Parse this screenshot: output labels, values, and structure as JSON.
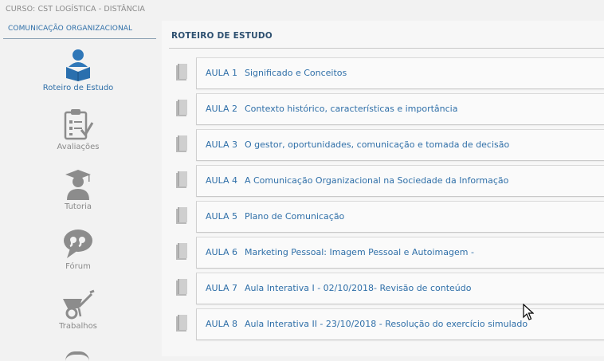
{
  "course": {
    "label": "CURSO: CST LOGÍSTICA - DISTÂNCIA"
  },
  "sidebar": {
    "module_title": "COMUNICAÇÃO ORGANIZACIONAL",
    "items": [
      {
        "label": "Roteiro de Estudo",
        "icon": "student-book-icon",
        "active": true
      },
      {
        "label": "Avaliações",
        "icon": "clipboard-check-icon",
        "active": false
      },
      {
        "label": "Tutoria",
        "icon": "graduate-icon",
        "active": false
      },
      {
        "label": "Fórum",
        "icon": "speech-bubble-icon",
        "active": false
      },
      {
        "label": "Trabalhos",
        "icon": "wheelbarrow-icon",
        "active": false
      }
    ]
  },
  "main": {
    "title": "ROTEIRO DE ESTUDO",
    "lessons": [
      {
        "number": "AULA 1",
        "title": "Significado e Conceitos"
      },
      {
        "number": "AULA 2",
        "title": "Contexto histórico, características e importância"
      },
      {
        "number": "AULA 3",
        "title": "O gestor, oportunidades, comunicação e tomada de decisão"
      },
      {
        "number": "AULA 4",
        "title": "A Comunicação Organizacional na Sociedade da Informação"
      },
      {
        "number": "AULA 5",
        "title": "Plano de Comunicação"
      },
      {
        "number": "AULA 6",
        "title": "Marketing Pessoal: Imagem Pessoal e Autoimagem -"
      },
      {
        "number": "AULA 7",
        "title": "Aula Interativa I - 02/10/2018- Revisão de conteúdo"
      },
      {
        "number": "AULA 8",
        "title": "Aula Interativa II - 23/10/2018 - Resolução do exercício simulado"
      }
    ]
  },
  "colors": {
    "accent": "#2f6fa8",
    "muted_text": "#8a8a8a",
    "icon_gray": "#8c8c8c"
  }
}
